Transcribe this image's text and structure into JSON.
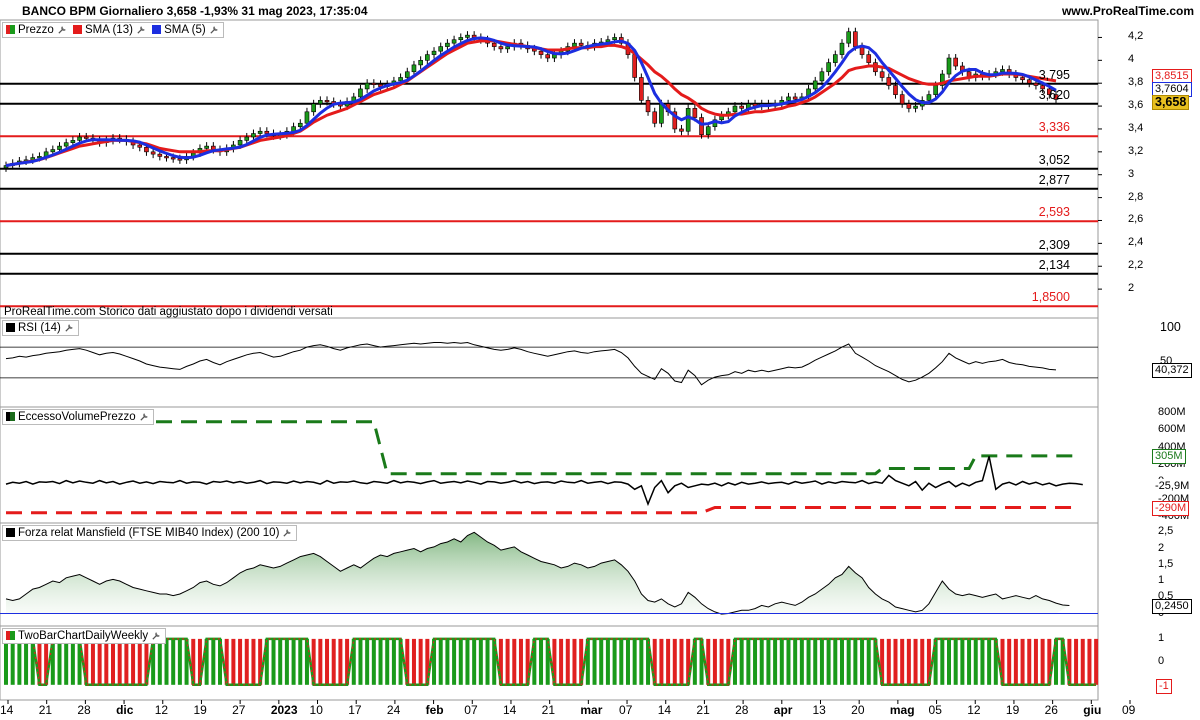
{
  "header": {
    "title": "BANCO BPM Giornaliero 3,658 -1,93% 31 mag 2023, 17:35:04",
    "site": "www.ProRealTime.com"
  },
  "panels": {
    "price": {
      "label": "Prezzo",
      "sma13": "SMA (13)",
      "sma5": "SMA (5)"
    },
    "rsi": {
      "label": "RSI (14)"
    },
    "evp": {
      "label": "EccessoVolumePrezzo"
    },
    "mansfield": {
      "label": "Forza relat Mansfield (FTSE MIB40 Index) (200 10)"
    },
    "twobar": {
      "label": "TwoBarChartDailyWeekly"
    }
  },
  "note": "ProRealTime.com Storico dati aggiustato dopo i dividendi versati",
  "colors": {
    "up": "#1a9a1a",
    "down": "#e02020",
    "sma13": "#e41b1b",
    "sma5": "#1c2ee0",
    "hline_black": "#000000",
    "hline_red": "#e41b1b"
  },
  "chart_data": [
    {
      "type": "candlestick",
      "panel": "price",
      "ylim": [
        1.8,
        4.3
      ],
      "yticks": [
        "4,2",
        "4",
        "3,8",
        "3,6",
        "3,4",
        "3,2",
        "3",
        "2,8",
        "2,6",
        "2,4",
        "2,2",
        "2"
      ],
      "ytick_values": [
        4.2,
        4.0,
        3.8,
        3.6,
        3.4,
        3.2,
        3.0,
        2.8,
        2.6,
        2.4,
        2.2,
        2.0
      ],
      "x_labels": [
        "14",
        "21",
        "28",
        "dic",
        "12",
        "19",
        "27",
        "2023",
        "10",
        "17",
        "24",
        "feb",
        "07",
        "14",
        "21",
        "mar",
        "07",
        "14",
        "21",
        "28",
        "apr",
        "13",
        "20",
        "mag",
        "05",
        "12",
        "19",
        "26",
        "giu",
        "09"
      ],
      "x_labels_bold": [
        "dic",
        "2023",
        "feb",
        "mar",
        "apr",
        "mag",
        "giu"
      ],
      "last_close": 3.658,
      "close": [
        3.08,
        3.1,
        3.12,
        3.13,
        3.15,
        3.16,
        3.2,
        3.22,
        3.25,
        3.28,
        3.3,
        3.33,
        3.32,
        3.3,
        3.28,
        3.3,
        3.32,
        3.31,
        3.29,
        3.26,
        3.24,
        3.2,
        3.18,
        3.16,
        3.15,
        3.14,
        3.13,
        3.16,
        3.19,
        3.23,
        3.25,
        3.22,
        3.2,
        3.23,
        3.26,
        3.3,
        3.33,
        3.36,
        3.38,
        3.36,
        3.34,
        3.35,
        3.38,
        3.42,
        3.45,
        3.55,
        3.62,
        3.65,
        3.64,
        3.62,
        3.6,
        3.64,
        3.68,
        3.75,
        3.8,
        3.79,
        3.77,
        3.79,
        3.82,
        3.85,
        3.9,
        3.96,
        4.0,
        4.05,
        4.08,
        4.12,
        4.15,
        4.18,
        4.2,
        4.22,
        4.2,
        4.18,
        4.15,
        4.12,
        4.1,
        4.12,
        4.15,
        4.13,
        4.1,
        4.08,
        4.05,
        4.02,
        4.05,
        4.08,
        4.12,
        4.15,
        4.13,
        4.12,
        4.15,
        4.16,
        4.18,
        4.2,
        4.15,
        4.05,
        3.85,
        3.65,
        3.55,
        3.45,
        3.62,
        3.55,
        3.4,
        3.38,
        3.58,
        3.5,
        3.35,
        3.42,
        3.48,
        3.52,
        3.55,
        3.6,
        3.58,
        3.62,
        3.6,
        3.62,
        3.6,
        3.62,
        3.65,
        3.68,
        3.66,
        3.68,
        3.75,
        3.82,
        3.9,
        3.98,
        4.05,
        4.15,
        4.25,
        4.12,
        4.05,
        3.98,
        3.9,
        3.85,
        3.78,
        3.7,
        3.62,
        3.58,
        3.6,
        3.65,
        3.7,
        3.78,
        3.88,
        4.02,
        3.95,
        3.9,
        3.85,
        3.88,
        3.86,
        3.88,
        3.9,
        3.92,
        3.88,
        3.85,
        3.83,
        3.8,
        3.78,
        3.75,
        3.7,
        3.658
      ],
      "sma13": [
        3.08,
        3.09,
        3.1,
        3.11,
        3.12,
        3.13,
        3.15,
        3.17,
        3.19,
        3.21,
        3.23,
        3.25,
        3.26,
        3.27,
        3.28,
        3.29,
        3.3,
        3.3,
        3.3,
        3.29,
        3.28,
        3.27,
        3.25,
        3.23,
        3.22,
        3.21,
        3.2,
        3.2,
        3.2,
        3.2,
        3.21,
        3.21,
        3.21,
        3.22,
        3.23,
        3.24,
        3.26,
        3.28,
        3.3,
        3.31,
        3.32,
        3.33,
        3.34,
        3.36,
        3.38,
        3.42,
        3.46,
        3.49,
        3.52,
        3.54,
        3.56,
        3.58,
        3.61,
        3.64,
        3.67,
        3.7,
        3.72,
        3.74,
        3.76,
        3.79,
        3.82,
        3.86,
        3.9,
        3.94,
        3.98,
        4.02,
        4.06,
        4.09,
        4.12,
        4.15,
        4.16,
        4.17,
        4.17,
        4.17,
        4.16,
        4.15,
        4.14,
        4.13,
        4.12,
        4.11,
        4.1,
        4.09,
        4.09,
        4.09,
        4.1,
        4.11,
        4.11,
        4.11,
        4.12,
        4.12,
        4.13,
        4.13,
        4.12,
        4.1,
        4.06,
        4.01,
        3.96,
        3.9,
        3.86,
        3.81,
        3.75,
        3.7,
        3.67,
        3.63,
        3.58,
        3.55,
        3.53,
        3.52,
        3.52,
        3.53,
        3.53,
        3.54,
        3.55,
        3.55,
        3.56,
        3.57,
        3.58,
        3.6,
        3.61,
        3.63,
        3.65,
        3.68,
        3.72,
        3.76,
        3.8,
        3.85,
        3.91,
        3.93,
        3.94,
        3.95,
        3.95,
        3.94,
        3.93,
        3.9,
        3.87,
        3.84,
        3.82,
        3.8,
        3.79,
        3.79,
        3.8,
        3.82,
        3.83,
        3.84,
        3.85,
        3.86,
        3.86,
        3.86,
        3.87,
        3.88,
        3.88,
        3.88,
        3.87,
        3.86,
        3.85,
        3.84,
        3.83,
        3.82
      ]
    },
    {
      "type": "line",
      "panel": "rsi",
      "ylim": [
        0,
        100
      ],
      "yticks": [
        "100",
        "50"
      ],
      "last_value": "40,372",
      "values": [
        55,
        56,
        58,
        57,
        59,
        60,
        62,
        63,
        64,
        66,
        67,
        68,
        66,
        63,
        60,
        62,
        63,
        61,
        58,
        55,
        52,
        48,
        46,
        44,
        43,
        42,
        41,
        45,
        48,
        52,
        54,
        50,
        47,
        51,
        54,
        57,
        60,
        62,
        63,
        60,
        57,
        58,
        61,
        64,
        66,
        70,
        72,
        73,
        71,
        68,
        66,
        69,
        71,
        73,
        74,
        72,
        70,
        71,
        72,
        73,
        74,
        75,
        74,
        75,
        76,
        76,
        75,
        76,
        75,
        76,
        73,
        71,
        69,
        67,
        66,
        67,
        69,
        67,
        64,
        62,
        60,
        58,
        60,
        62,
        64,
        65,
        63,
        62,
        64,
        65,
        66,
        67,
        63,
        56,
        45,
        36,
        32,
        28,
        42,
        36,
        26,
        24,
        40,
        33,
        21,
        27,
        31,
        33,
        34,
        38,
        36,
        40,
        38,
        40,
        38,
        40,
        42,
        44,
        43,
        44,
        48,
        53,
        57,
        61,
        65,
        70,
        74,
        62,
        57,
        52,
        46,
        42,
        38,
        33,
        28,
        25,
        27,
        31,
        36,
        43,
        51,
        62,
        56,
        52,
        48,
        51,
        49,
        51,
        52,
        54,
        50,
        48,
        47,
        45,
        44,
        43,
        41,
        40.4
      ]
    },
    {
      "type": "line",
      "panel": "evp",
      "ylim": [
        -400,
        800
      ],
      "yticks": [
        "800M",
        "600M",
        "400M",
        "200M",
        "0",
        "-200M",
        "-400M"
      ],
      "tags": [
        "305M",
        "-25,9M",
        "-290M"
      ],
      "upper_band": [
        {
          "x": 0,
          "y": 700
        },
        {
          "x": 55,
          "y": 700
        },
        {
          "x": 57,
          "y": 100
        },
        {
          "x": 130,
          "y": 100
        },
        {
          "x": 131,
          "y": 160
        },
        {
          "x": 144,
          "y": 160
        },
        {
          "x": 145,
          "y": 305
        },
        {
          "x": 160,
          "y": 305
        }
      ],
      "lower_band": [
        {
          "x": 0,
          "y": -350
        },
        {
          "x": 104,
          "y": -350
        },
        {
          "x": 106,
          "y": -290
        },
        {
          "x": 160,
          "y": -290
        }
      ],
      "values": [
        -20,
        0,
        -10,
        10,
        -20,
        5,
        0,
        10,
        -15,
        20,
        -5,
        15,
        0,
        -10,
        20,
        -5,
        10,
        -20,
        0,
        15,
        -10,
        5,
        -15,
        10,
        0,
        -5,
        20,
        -10,
        5,
        0,
        -20,
        10,
        0,
        15,
        -5,
        10,
        -10,
        0,
        20,
        -15,
        5,
        0,
        -10,
        15,
        -5,
        10,
        0,
        -20,
        20,
        -10,
        5,
        0,
        15,
        -5,
        -15,
        10,
        0,
        -10,
        20,
        -5,
        10,
        0,
        -15,
        5,
        20,
        -10,
        0,
        10,
        -5,
        15,
        0,
        -20,
        10,
        5,
        -10,
        0,
        20,
        -5,
        10,
        -15,
        0,
        5,
        -10,
        15,
        0,
        -5,
        20,
        -10,
        0,
        10,
        -15,
        5,
        0,
        -20,
        -80,
        -40,
        -250,
        -60,
        20,
        -120,
        -40,
        -10,
        -60,
        -40,
        -20,
        -30,
        -10,
        -40,
        -5,
        -30,
        0,
        -20,
        -10,
        5,
        -15,
        -5,
        0,
        -20,
        10,
        -10,
        0,
        15,
        -20,
        5,
        -10,
        10,
        0,
        -5,
        20,
        -15,
        5,
        -10,
        80,
        20,
        -10,
        -40,
        10,
        -90,
        -10,
        -60,
        -20,
        10,
        -50,
        -10,
        -40,
        0,
        20,
        300,
        -80,
        -20,
        0,
        -30,
        10,
        -20,
        0,
        -30,
        -10,
        -40,
        -20,
        -10,
        -15,
        -25.9
      ]
    },
    {
      "type": "area",
      "panel": "mansfield",
      "ylim": [
        -0.2,
        2.6
      ],
      "yticks": [
        "2,5",
        "2",
        "1,5",
        "1",
        "0,5",
        "0"
      ],
      "last_value": "0,2450",
      "values": [
        0.45,
        0.4,
        0.45,
        0.6,
        0.75,
        0.8,
        0.9,
        1.0,
        0.95,
        1.1,
        1.15,
        1.2,
        1.1,
        1.0,
        0.9,
        1.0,
        1.05,
        1.0,
        0.9,
        0.8,
        0.75,
        0.7,
        0.65,
        0.6,
        0.6,
        0.55,
        0.6,
        0.7,
        0.8,
        0.95,
        1.0,
        0.9,
        0.85,
        0.95,
        1.1,
        1.25,
        1.35,
        1.4,
        1.5,
        1.45,
        1.4,
        1.45,
        1.55,
        1.65,
        1.75,
        1.8,
        1.85,
        1.75,
        1.6,
        1.45,
        1.3,
        1.4,
        1.5,
        1.4,
        1.55,
        1.7,
        1.8,
        1.75,
        1.85,
        1.9,
        1.95,
        2.0,
        1.9,
        2.0,
        2.05,
        2.15,
        2.2,
        2.3,
        2.2,
        2.4,
        2.5,
        2.35,
        2.2,
        2.1,
        1.95,
        2.0,
        2.05,
        1.9,
        1.8,
        1.7,
        1.6,
        1.55,
        1.5,
        1.4,
        1.45,
        1.55,
        1.5,
        1.4,
        1.45,
        1.55,
        1.6,
        1.65,
        1.5,
        1.3,
        1.0,
        0.6,
        0.4,
        0.35,
        0.45,
        0.3,
        0.2,
        0.3,
        0.65,
        0.5,
        0.3,
        0.15,
        0.05,
        -0.02,
        0.0,
        0.05,
        0.1,
        0.1,
        0.15,
        0.25,
        0.2,
        0.3,
        0.35,
        0.3,
        0.25,
        0.35,
        0.5,
        0.6,
        0.75,
        0.9,
        1.1,
        1.2,
        1.45,
        1.25,
        1.1,
        0.8,
        0.6,
        0.45,
        0.35,
        0.2,
        0.15,
        0.1,
        0.05,
        0.1,
        0.3,
        0.65,
        1.0,
        0.75,
        0.6,
        0.55,
        0.6,
        0.55,
        0.5,
        0.55,
        0.6,
        0.45,
        0.5,
        0.55,
        0.5,
        0.45,
        0.55,
        0.45,
        0.4,
        0.32,
        0.26,
        0.245
      ]
    },
    {
      "type": "line",
      "panel": "twobar",
      "ylim": [
        -1.4,
        1.3
      ],
      "yticks": [
        "1",
        "0"
      ],
      "tags": [
        "-1"
      ],
      "values": [
        1,
        1,
        1,
        1,
        1,
        -1,
        -1,
        1,
        1,
        1,
        1,
        1,
        -1,
        -1,
        -1,
        -1,
        -1,
        -1,
        -1,
        -1,
        -1,
        -1,
        1,
        1,
        1,
        1,
        1,
        1,
        -1,
        -1,
        1,
        1,
        1,
        -1,
        -1,
        -1,
        -1,
        -1,
        -1,
        1,
        1,
        1,
        1,
        1,
        1,
        1,
        -1,
        -1,
        -1,
        -1,
        -1,
        -1,
        1,
        1,
        1,
        1,
        1,
        1,
        1,
        1,
        -1,
        -1,
        -1,
        -1,
        1,
        1,
        1,
        1,
        1,
        1,
        1,
        1,
        1,
        1,
        -1,
        -1,
        -1,
        -1,
        -1,
        1,
        1,
        1,
        -1,
        -1,
        -1,
        -1,
        -1,
        1,
        1,
        1,
        1,
        1,
        1,
        1,
        1,
        1,
        1,
        -1,
        -1,
        -1,
        -1,
        -1,
        -1,
        1,
        1,
        -1,
        -1,
        -1,
        -1,
        1,
        1,
        1,
        1,
        1,
        1,
        1,
        1,
        1,
        1,
        1,
        1,
        1,
        1,
        1,
        1,
        1,
        1,
        1,
        1,
        1,
        1,
        -1,
        -1,
        -1,
        -1,
        -1,
        -1,
        -1,
        -1,
        1,
        1,
        1,
        1,
        1,
        1,
        1,
        1,
        1,
        1,
        -1,
        -1,
        -1,
        -1,
        -1,
        -1,
        -1,
        -1,
        1,
        1,
        -1,
        -1,
        -1,
        -1,
        -1
      ]
    }
  ],
  "levels": [
    {
      "value": "3,795",
      "y": 3.795,
      "color": "#000000"
    },
    {
      "value": "3,620",
      "y": 3.62,
      "color": "#000000"
    },
    {
      "value": "3,336",
      "y": 3.336,
      "color": "#e41b1b"
    },
    {
      "value": "3,052",
      "y": 3.052,
      "color": "#000000"
    },
    {
      "value": "2,877",
      "y": 2.877,
      "color": "#000000"
    },
    {
      "value": "2,593",
      "y": 2.593,
      "color": "#e41b1b"
    },
    {
      "value": "2,309",
      "y": 2.309,
      "color": "#000000"
    },
    {
      "value": "2,134",
      "y": 2.134,
      "color": "#000000"
    },
    {
      "value": "1,8500",
      "y": 1.85,
      "color": "#e41b1b"
    }
  ],
  "price_tags": {
    "sma13": "3,8515",
    "sma5": "3,7604",
    "last": "3,658"
  }
}
